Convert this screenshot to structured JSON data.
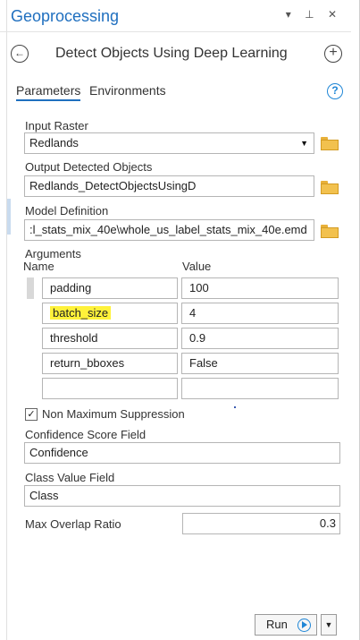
{
  "pane": {
    "title": "Geoprocessing",
    "controls": "▾ ⊥ ✕",
    "tool_title": "Detect Objects Using Deep Learning"
  },
  "tabs": [
    {
      "label": "Parameters",
      "active": true
    },
    {
      "label": "Environments",
      "active": false
    }
  ],
  "fields": {
    "input_raster": {
      "label": "Input Raster",
      "value": "Redlands"
    },
    "output": {
      "label": "Output Detected Objects",
      "value": "Redlands_DetectObjectsUsingD"
    },
    "model_def": {
      "label": "Model Definition",
      "value": ":l_stats_mix_40e\\whole_us_label_stats_mix_40e.emd"
    }
  },
  "arguments": {
    "label": "Arguments",
    "col_name": "Name",
    "col_value": "Value",
    "rows": [
      {
        "name": "padding",
        "value": "100"
      },
      {
        "name": "batch_size",
        "value": "4",
        "highlighted": true
      },
      {
        "name": "threshold",
        "value": "0.9"
      },
      {
        "name": "return_bboxes",
        "value": "False"
      },
      {
        "name": "",
        "value": ""
      }
    ]
  },
  "nms": {
    "label": "Non Maximum Suppression",
    "checked": true,
    "check_glyph": "✓"
  },
  "confidence": {
    "label": "Confidence Score Field",
    "value": "Confidence"
  },
  "class_field": {
    "label": "Class Value Field",
    "value": "Class"
  },
  "overlap": {
    "label": "Max Overlap Ratio",
    "value": "0.3"
  },
  "run": {
    "label": "Run"
  },
  "colors": {
    "accent": "#1f6fbf",
    "highlight": "#fff23a",
    "folder": "#f2c14e"
  }
}
